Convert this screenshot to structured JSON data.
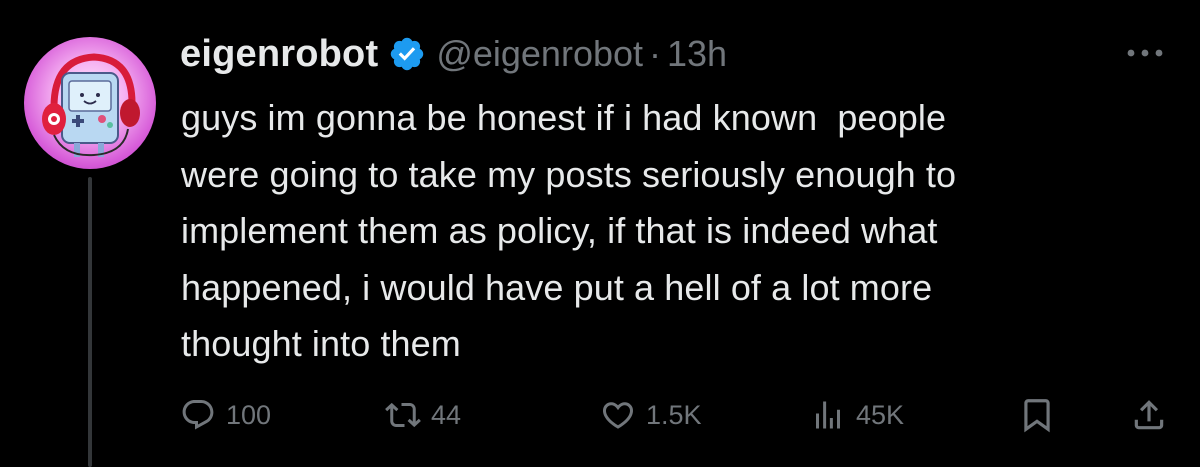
{
  "tweet": {
    "display_name": "eigenrobot",
    "handle": "@eigenrobot",
    "separator": "·",
    "time": "13h",
    "verified": true,
    "body": "guys im gonna be honest if i had known  people\nwere going to take my posts seriously enough to\nimplement them as policy, if that is indeed what\nhappened, i would have put a hell of a lot more\nthought into them"
  },
  "actions": {
    "replies": "100",
    "reposts": "44",
    "likes": "1.5K",
    "views": "45K"
  },
  "icons": {
    "verified": "verified-badge-icon",
    "more": "more-horizontal-icon",
    "reply": "reply-icon",
    "repost": "repost-icon",
    "like": "heart-icon",
    "views": "analytics-icon",
    "bookmark": "bookmark-icon",
    "share": "share-icon"
  },
  "colors": {
    "background": "#000000",
    "primary_text": "#e7e9ea",
    "secondary_text": "#71767b",
    "verified_blue": "#1d9bf0",
    "thread_line": "#333639"
  }
}
